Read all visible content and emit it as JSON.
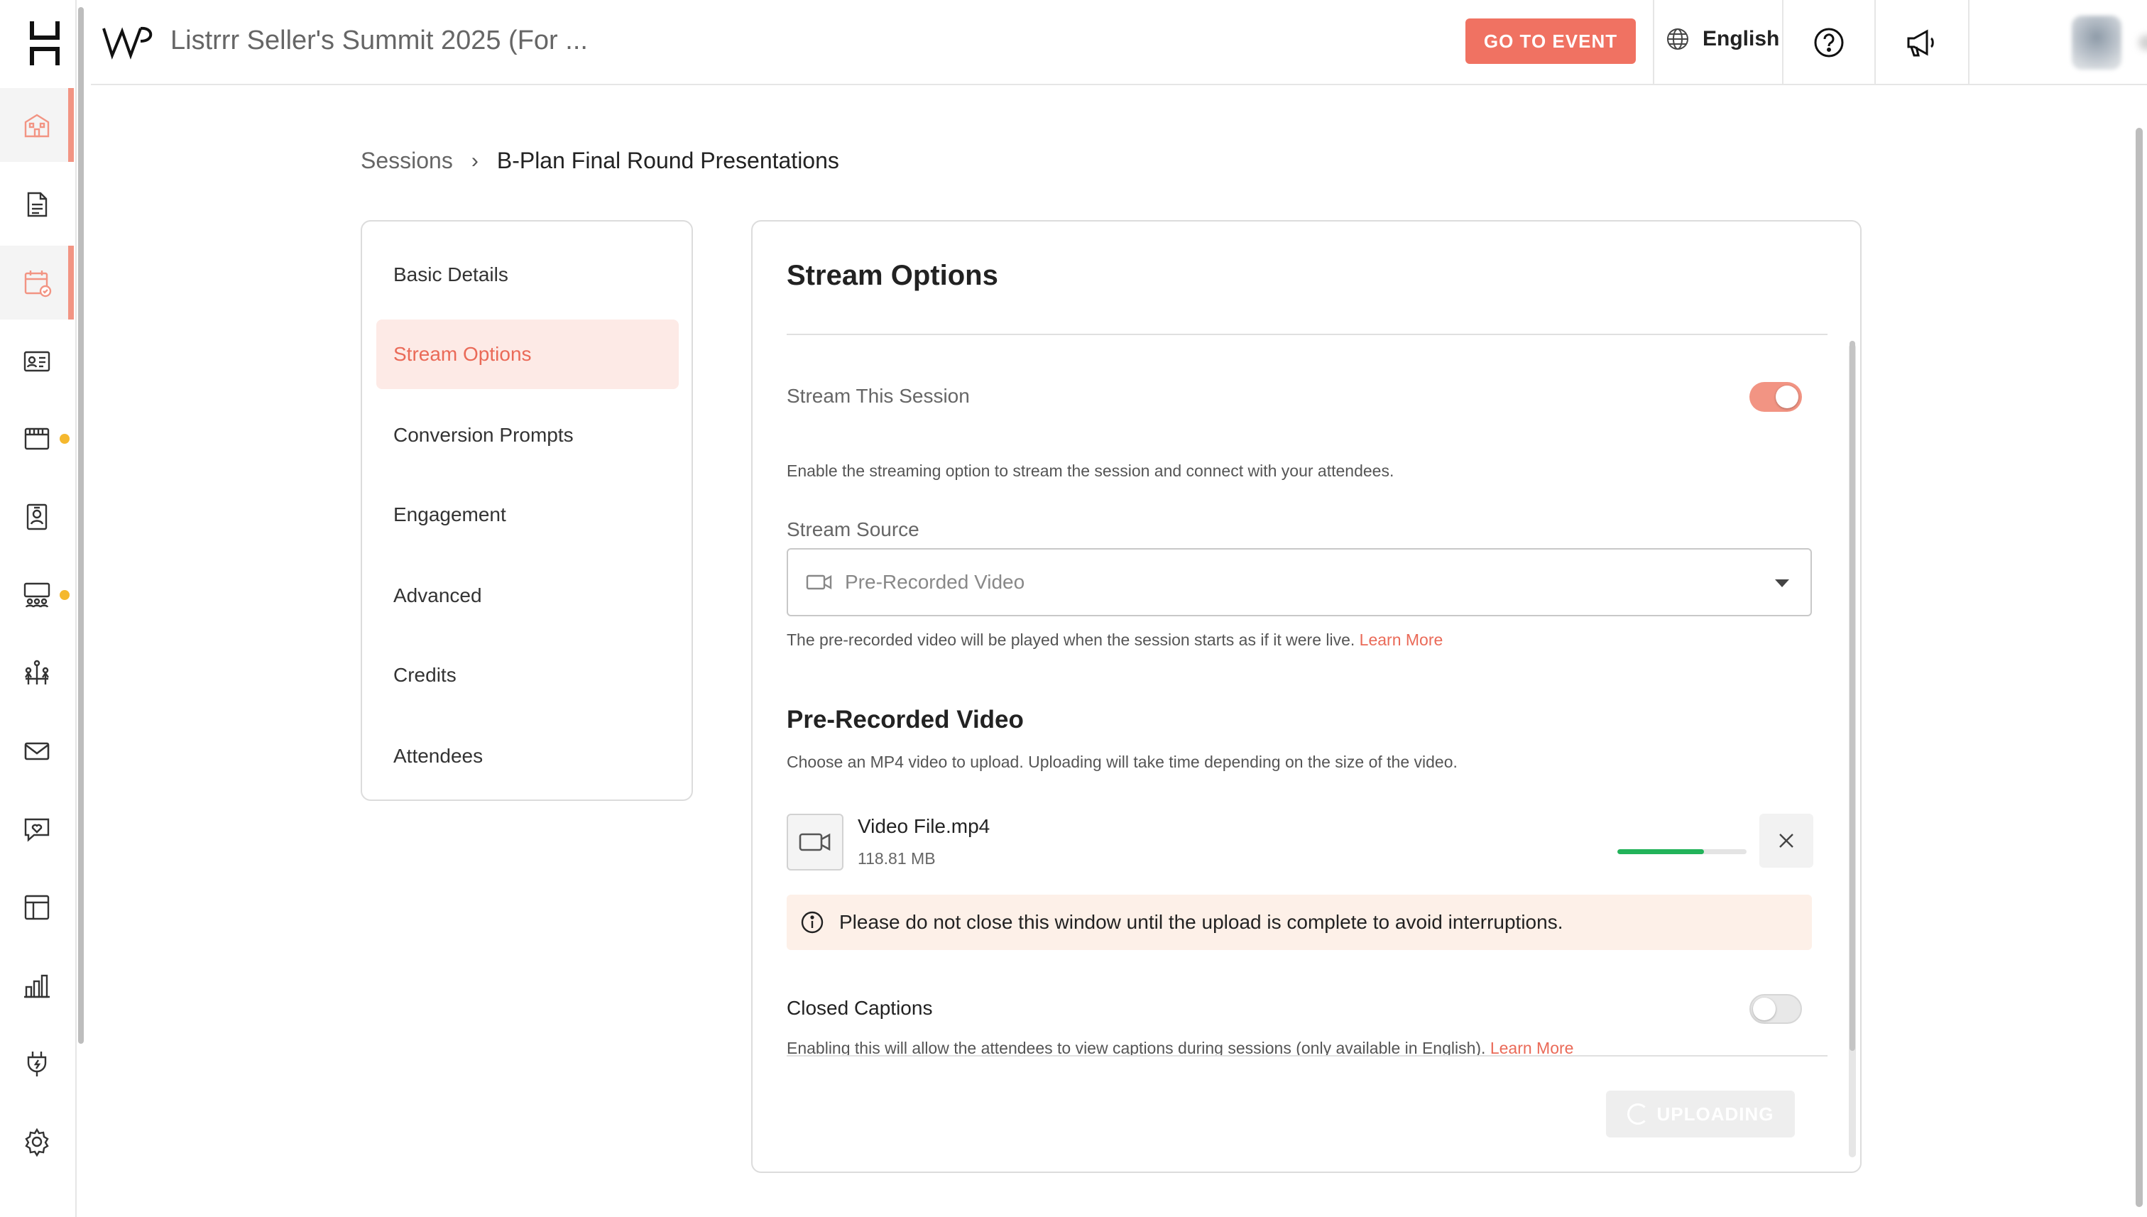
{
  "topbar": {
    "event_title": "Listrrr Seller's Summit 2025 (For ...",
    "go_to_event_label": "GO TO EVENT",
    "language": "English"
  },
  "rail": {
    "items": [
      {
        "icon": "building-icon",
        "active": true
      },
      {
        "icon": "document-icon",
        "active": false
      },
      {
        "icon": "calendar-icon",
        "active": true
      },
      {
        "icon": "id-card-icon",
        "active": false
      },
      {
        "icon": "booth-icon",
        "active": false,
        "dot": true
      },
      {
        "icon": "badge-icon",
        "active": false
      },
      {
        "icon": "stage-icon",
        "active": false,
        "dot": true
      },
      {
        "icon": "networking-icon",
        "active": false
      },
      {
        "icon": "mail-icon",
        "active": false
      },
      {
        "icon": "chat-heart-icon",
        "active": false
      },
      {
        "icon": "layout-icon",
        "active": false
      },
      {
        "icon": "analytics-icon",
        "active": false
      },
      {
        "icon": "plug-icon",
        "active": false
      },
      {
        "icon": "settings-icon",
        "active": false
      }
    ]
  },
  "breadcrumb": {
    "parent": "Sessions",
    "current": "B-Plan Final Round Presentations"
  },
  "side_nav": {
    "items": [
      {
        "label": "Basic Details",
        "active": false
      },
      {
        "label": "Stream Options",
        "active": true
      },
      {
        "label": "Conversion Prompts",
        "active": false
      },
      {
        "label": "Engagement",
        "active": false
      },
      {
        "label": "Advanced",
        "active": false
      },
      {
        "label": "Credits",
        "active": false
      },
      {
        "label": "Attendees",
        "active": false
      }
    ]
  },
  "main": {
    "title": "Stream Options",
    "stream_toggle": {
      "label": "Stream This Session",
      "on": true,
      "help": "Enable the streaming option to stream the session and connect with your attendees."
    },
    "stream_source": {
      "label": "Stream Source",
      "value": "Pre-Recorded Video",
      "help": "The pre-recorded video will be played when the session starts as if it were live.",
      "learn_more": "Learn More"
    },
    "prerecorded": {
      "title": "Pre-Recorded Video",
      "help": "Choose an MP4 video to upload. Uploading will take time depending on the size of the video.",
      "file_name": "Video File.mp4",
      "file_size": "118.81 MB",
      "progress_label": "67%",
      "progress": 0.67,
      "notice": "Please do not close this window until the upload is complete to avoid interruptions."
    },
    "closed_captions": {
      "label": "Closed Captions",
      "on": false,
      "help": "Enabling this will allow the attendees to view captions during sessions (only available in English).",
      "learn_more": "Learn More"
    },
    "upload_button_label": "UPLOADING"
  },
  "colors": {
    "accent": "#f07262",
    "accent_soft": "#fdeae6",
    "progress": "#22b35a",
    "notice_bg": "#fdf0e8",
    "rail_dot": "#f5b82e"
  }
}
